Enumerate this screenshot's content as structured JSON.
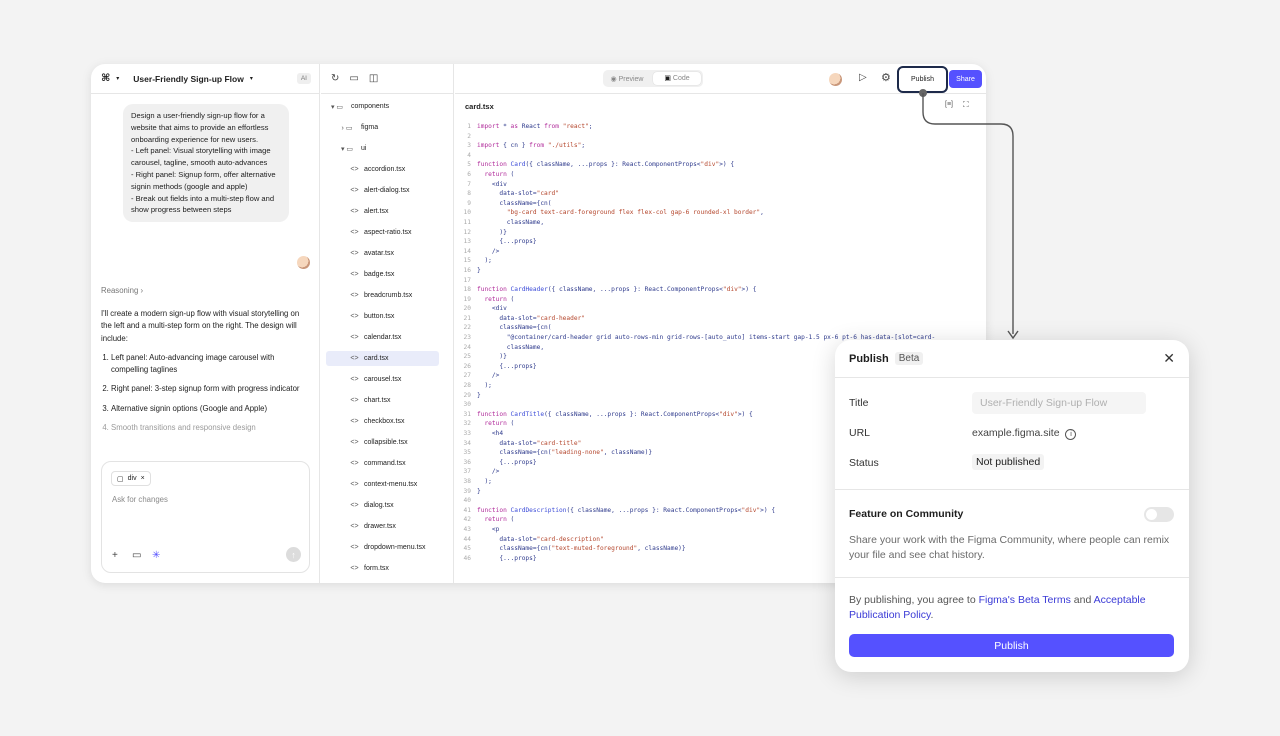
{
  "colors": {
    "accent": "#5551ff",
    "background": "#f3f3f3",
    "link": "#3a3ad6"
  },
  "chat": {
    "project_name": "User-Friendly Sign-up Flow",
    "ai_badge": "AI",
    "user_message": "Design a user-friendly sign-up flow for a website that aims to provide an effortless onboarding experience for new users.\n - Left panel: Visual storytelling with image carousel, tagline, smooth auto-advances\n - Right panel: Signup form, offer alternative signin methods (google and apple)\n - Break out fields into a multi-step flow and show progress between steps",
    "reasoning_label": "Reasoning",
    "response_intro": "I'll create a modern sign-up flow with visual storytelling on the left and a multi-step form on the right. The design will include:",
    "response_items": [
      "Left panel: Auto-advancing image carousel with compelling taglines",
      "Right panel: 3-step signup form with progress indicator",
      "Alternative signin options (Google and Apple)",
      "Smooth transitions and responsive design"
    ],
    "chip_label": "div",
    "input_placeholder": "Ask for changes"
  },
  "tree": {
    "root": "components",
    "folders": [
      "figma",
      "ui"
    ],
    "files": [
      "accordion.tsx",
      "alert-dialog.tsx",
      "alert.tsx",
      "aspect-ratio.tsx",
      "avatar.tsx",
      "badge.tsx",
      "breadcrumb.tsx",
      "button.tsx",
      "calendar.tsx",
      "card.tsx",
      "carousel.tsx",
      "chart.tsx",
      "checkbox.tsx",
      "collapsible.tsx",
      "command.tsx",
      "context-menu.tsx",
      "dialog.tsx",
      "drawer.tsx",
      "dropdown-menu.tsx",
      "form.tsx"
    ],
    "selected": "card.tsx"
  },
  "toolbar": {
    "preview": "Preview",
    "code": "Code",
    "publish": "Publish",
    "share": "Share"
  },
  "editor": {
    "filename": "card.tsx",
    "lines": [
      "import * as React from \"react\";",
      "",
      "import { cn } from \"./utils\";",
      "",
      "function Card({ className, ...props }: React.ComponentProps<\"div\">) {",
      "  return (",
      "    <div",
      "      data-slot=\"card\"",
      "      className={cn(",
      "        \"bg-card text-card-foreground flex flex-col gap-6 rounded-xl border\",",
      "        className,",
      "      )}",
      "      {...props}",
      "    />",
      "  );",
      "}",
      "",
      "function CardHeader({ className, ...props }: React.ComponentProps<\"div\">) {",
      "  return (",
      "    <div",
      "      data-slot=\"card-header\"",
      "      className={cn(",
      "        \"@container/card-header grid auto-rows-min grid-rows-[auto_auto] items-start gap-1.5 px-6 pt-6 has-data-[slot=card-",
      "        className,",
      "      )}",
      "      {...props}",
      "    />",
      "  );",
      "}",
      "",
      "function CardTitle({ className, ...props }: React.ComponentProps<\"div\">) {",
      "  return (",
      "    <h4",
      "      data-slot=\"card-title\"",
      "      className={cn(\"leading-none\", className)}",
      "      {...props}",
      "    />",
      "  );",
      "}",
      "",
      "function CardDescription({ className, ...props }: React.ComponentProps<\"div\">) {",
      "  return (",
      "    <p",
      "      data-slot=\"card-description\"",
      "      className={cn(\"text-muted-foreground\", className)}",
      "      {...props}"
    ]
  },
  "dialog": {
    "title": "Publish",
    "beta": "Beta",
    "title_label": "Title",
    "title_placeholder": "User-Friendly Sign-up Flow",
    "url_label": "URL",
    "url_value": "example.figma.site",
    "status_label": "Status",
    "status_value": "Not published",
    "feature_label": "Feature on Community",
    "feature_desc": "Share your work with the Figma Community, where people can remix your file and see chat history.",
    "terms_prefix": "By publishing, you agree to ",
    "terms_link1": "Figma's Beta Terms",
    "terms_mid": " and ",
    "terms_link2": "Acceptable Publication Policy",
    "terms_suffix": ".",
    "publish_button": "Publish"
  }
}
